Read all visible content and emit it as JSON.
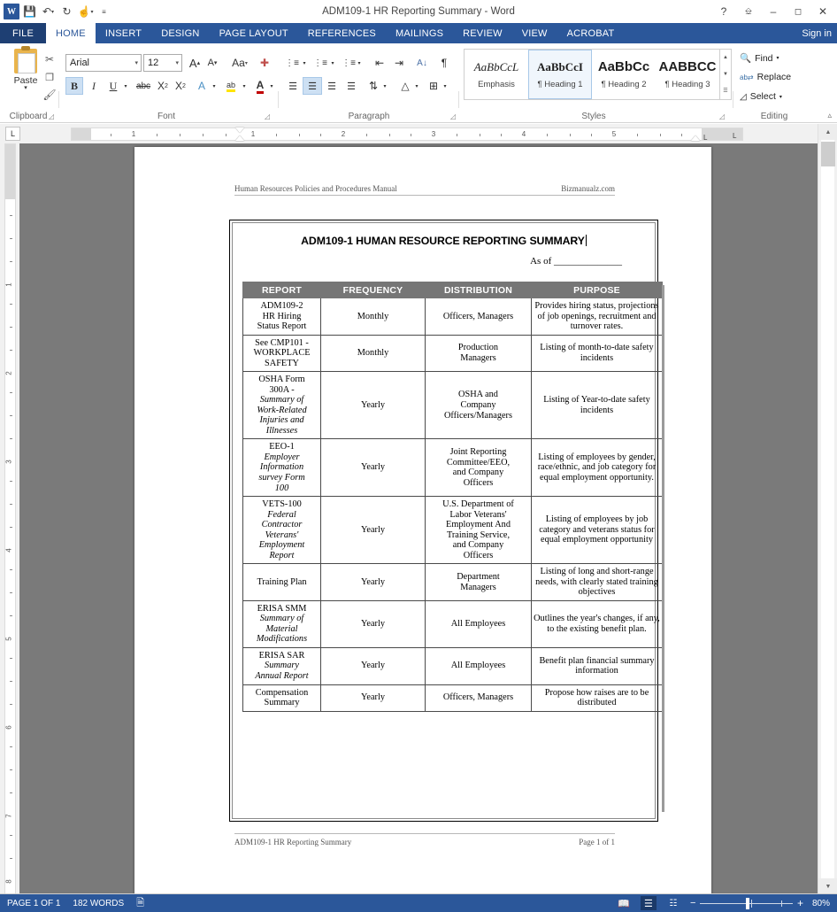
{
  "titlebar": {
    "app_logo": "word-logo",
    "document_title": "ADM109-1 HR Reporting Summary - Word",
    "qat": [
      {
        "name": "save",
        "glyph": "ὋE"
      },
      {
        "name": "undo",
        "glyph": "↶"
      },
      {
        "name": "redo",
        "glyph": "↻"
      },
      {
        "name": "touch-mode",
        "glyph": "☝"
      },
      {
        "name": "customize",
        "glyph": "≡"
      }
    ],
    "help_glyph": "?",
    "ribbon_display_glyph": "⌷",
    "minimize_glyph": "–",
    "maximize_glyph": "☐",
    "close_glyph": "✕",
    "sign_in": "Sign in"
  },
  "tabs": {
    "file": "FILE",
    "items": [
      "HOME",
      "INSERT",
      "DESIGN",
      "PAGE LAYOUT",
      "REFERENCES",
      "MAILINGS",
      "REVIEW",
      "VIEW",
      "ACROBAT"
    ],
    "active": "HOME"
  },
  "ribbon": {
    "groups": [
      "Clipboard",
      "Font",
      "Paragraph",
      "Styles",
      "Editing"
    ],
    "clipboard": {
      "paste_label": "Paste",
      "cut": "✂",
      "copy": "❐",
      "format_painter": "✐"
    },
    "font": {
      "font_name": "Arial",
      "font_size": "12",
      "grow_font": "A",
      "shrink_font": "A",
      "change_case": "Aa",
      "clear_formatting": "὘C",
      "bold": "B",
      "italic": "I",
      "underline": "U",
      "strikethrough": "abc",
      "subscript": "X",
      "superscript": "X",
      "text_effects": "A",
      "highlight": "ab",
      "font_color": "A"
    },
    "paragraph": {
      "bullets": "☰",
      "numbering": "☰",
      "multilevel": "☰",
      "decrease_indent": "⇤",
      "increase_indent": "⇥",
      "sort": "A↓",
      "show_marks": "¶",
      "align_left": "≡",
      "align_center": "≡",
      "align_right": "≡",
      "justify": "≡",
      "line_spacing": "⇅",
      "shading": "△",
      "borders": "⊞"
    },
    "styles": {
      "items": [
        {
          "preview": "AaBbCcL",
          "name": "Emphasis",
          "selected": false,
          "italic": true
        },
        {
          "preview": "AaBbCcI",
          "name": "¶ Heading 1",
          "selected": true,
          "italic": false
        },
        {
          "preview": "AaBbCc",
          "name": "¶ Heading 2",
          "selected": false,
          "italic": false
        },
        {
          "preview": "AABBCC",
          "name": "¶ Heading 3",
          "selected": false,
          "italic": false
        }
      ]
    },
    "editing": {
      "find": "Find",
      "replace": "Replace",
      "select": "Select",
      "find_icon": "ὐD",
      "replace_icon": "ab",
      "select_icon": "↖"
    },
    "collapse_glyph": "∧"
  },
  "ruler": {
    "tab_selector": "L",
    "h_numbers": [
      "1",
      "1",
      "2",
      "3",
      "4",
      "5"
    ],
    "v_numbers": [
      "1",
      "2",
      "3",
      "4",
      "5",
      "6",
      "7",
      "8"
    ],
    "tab_stop_left": "L",
    "tab_stop_right": "L"
  },
  "document": {
    "header_left": "Human Resources Policies and Procedures Manual",
    "header_right": "Bizmanualz.com",
    "title": "ADM109-1 HUMAN RESOURCE REPORTING SUMMARY",
    "as_of_label": "As of ______________",
    "footer_left": "ADM109-1 HR Reporting Summary",
    "footer_right": "Page 1 of 1",
    "table": {
      "headers": [
        "REPORT",
        "FREQUENCY",
        "DISTRIBUTION",
        "PURPOSE"
      ],
      "header_bg": "#767676",
      "rows": [
        {
          "report_main": "ADM109-2\nHR Hiring\nStatus Report",
          "report_italic": "",
          "frequency": "Monthly",
          "distribution": "Officers, Managers",
          "purpose": "Provides hiring status, projections of job openings, recruitment and turnover rates."
        },
        {
          "report_main": "See CMP101 -\nWORKPLACE\nSAFETY",
          "report_italic": "",
          "frequency": "Monthly",
          "distribution": "Production\nManagers",
          "purpose": "Listing of month-to-date safety incidents"
        },
        {
          "report_main": "OSHA Form\n300A -",
          "report_italic": "Summary of\nWork-Related\nInjuries and\nIllnesses",
          "frequency": "Yearly",
          "distribution": "OSHA and\nCompany\nOfficers/Managers",
          "purpose": "Listing of Year-to-date safety incidents"
        },
        {
          "report_main": "EEO-1",
          "report_italic": "Employer\nInformation\nsurvey Form\n100",
          "frequency": "Yearly",
          "distribution": "Joint Reporting\nCommittee/EEO,\nand Company\nOfficers",
          "purpose": "Listing of employees by gender, race/ethnic, and job category for equal employment opportunity."
        },
        {
          "report_main": "VETS-100",
          "report_italic": "Federal\nContractor\nVeterans'\nEmployment\nReport",
          "frequency": "Yearly",
          "distribution": "U.S. Department of\nLabor Veterans'\nEmployment And\nTraining Service,\nand Company\nOfficers",
          "purpose": "Listing of employees by job category and veterans status for equal employment opportunity"
        },
        {
          "report_main": "Training Plan",
          "report_italic": "",
          "frequency": "Yearly",
          "distribution": "Department\nManagers",
          "purpose": "Listing of long and short-range needs, with clearly stated training objectives"
        },
        {
          "report_main": "ERISA SMM",
          "report_italic": "Summary of\nMaterial\nModifications",
          "frequency": "Yearly",
          "distribution": "All Employees",
          "purpose": "Outlines the year's changes, if any, to the existing benefit plan."
        },
        {
          "report_main": "ERISA SAR",
          "report_italic": "Summary\nAnnual Report",
          "frequency": "Yearly",
          "distribution": "All Employees",
          "purpose": "Benefit plan financial summary information"
        },
        {
          "report_main": "Compensation\nSummary",
          "report_italic": "",
          "frequency": "Yearly",
          "distribution": "Officers, Managers",
          "purpose": "Propose how raises are to be distributed"
        }
      ]
    }
  },
  "statusbar": {
    "page_info": "PAGE 1 OF 1",
    "word_count": "182 WORDS",
    "proofing_icon": "Ὅ6",
    "view_read": "Ὅ6",
    "view_print": "☰",
    "view_web": "὜E",
    "zoom_out": "−",
    "zoom_in": "+",
    "zoom_level": "80%"
  },
  "colors": {
    "accent": "#2b579a",
    "file_tab": "#1e3f73",
    "table_header": "#767676",
    "canvas": "#7a7a7a"
  }
}
